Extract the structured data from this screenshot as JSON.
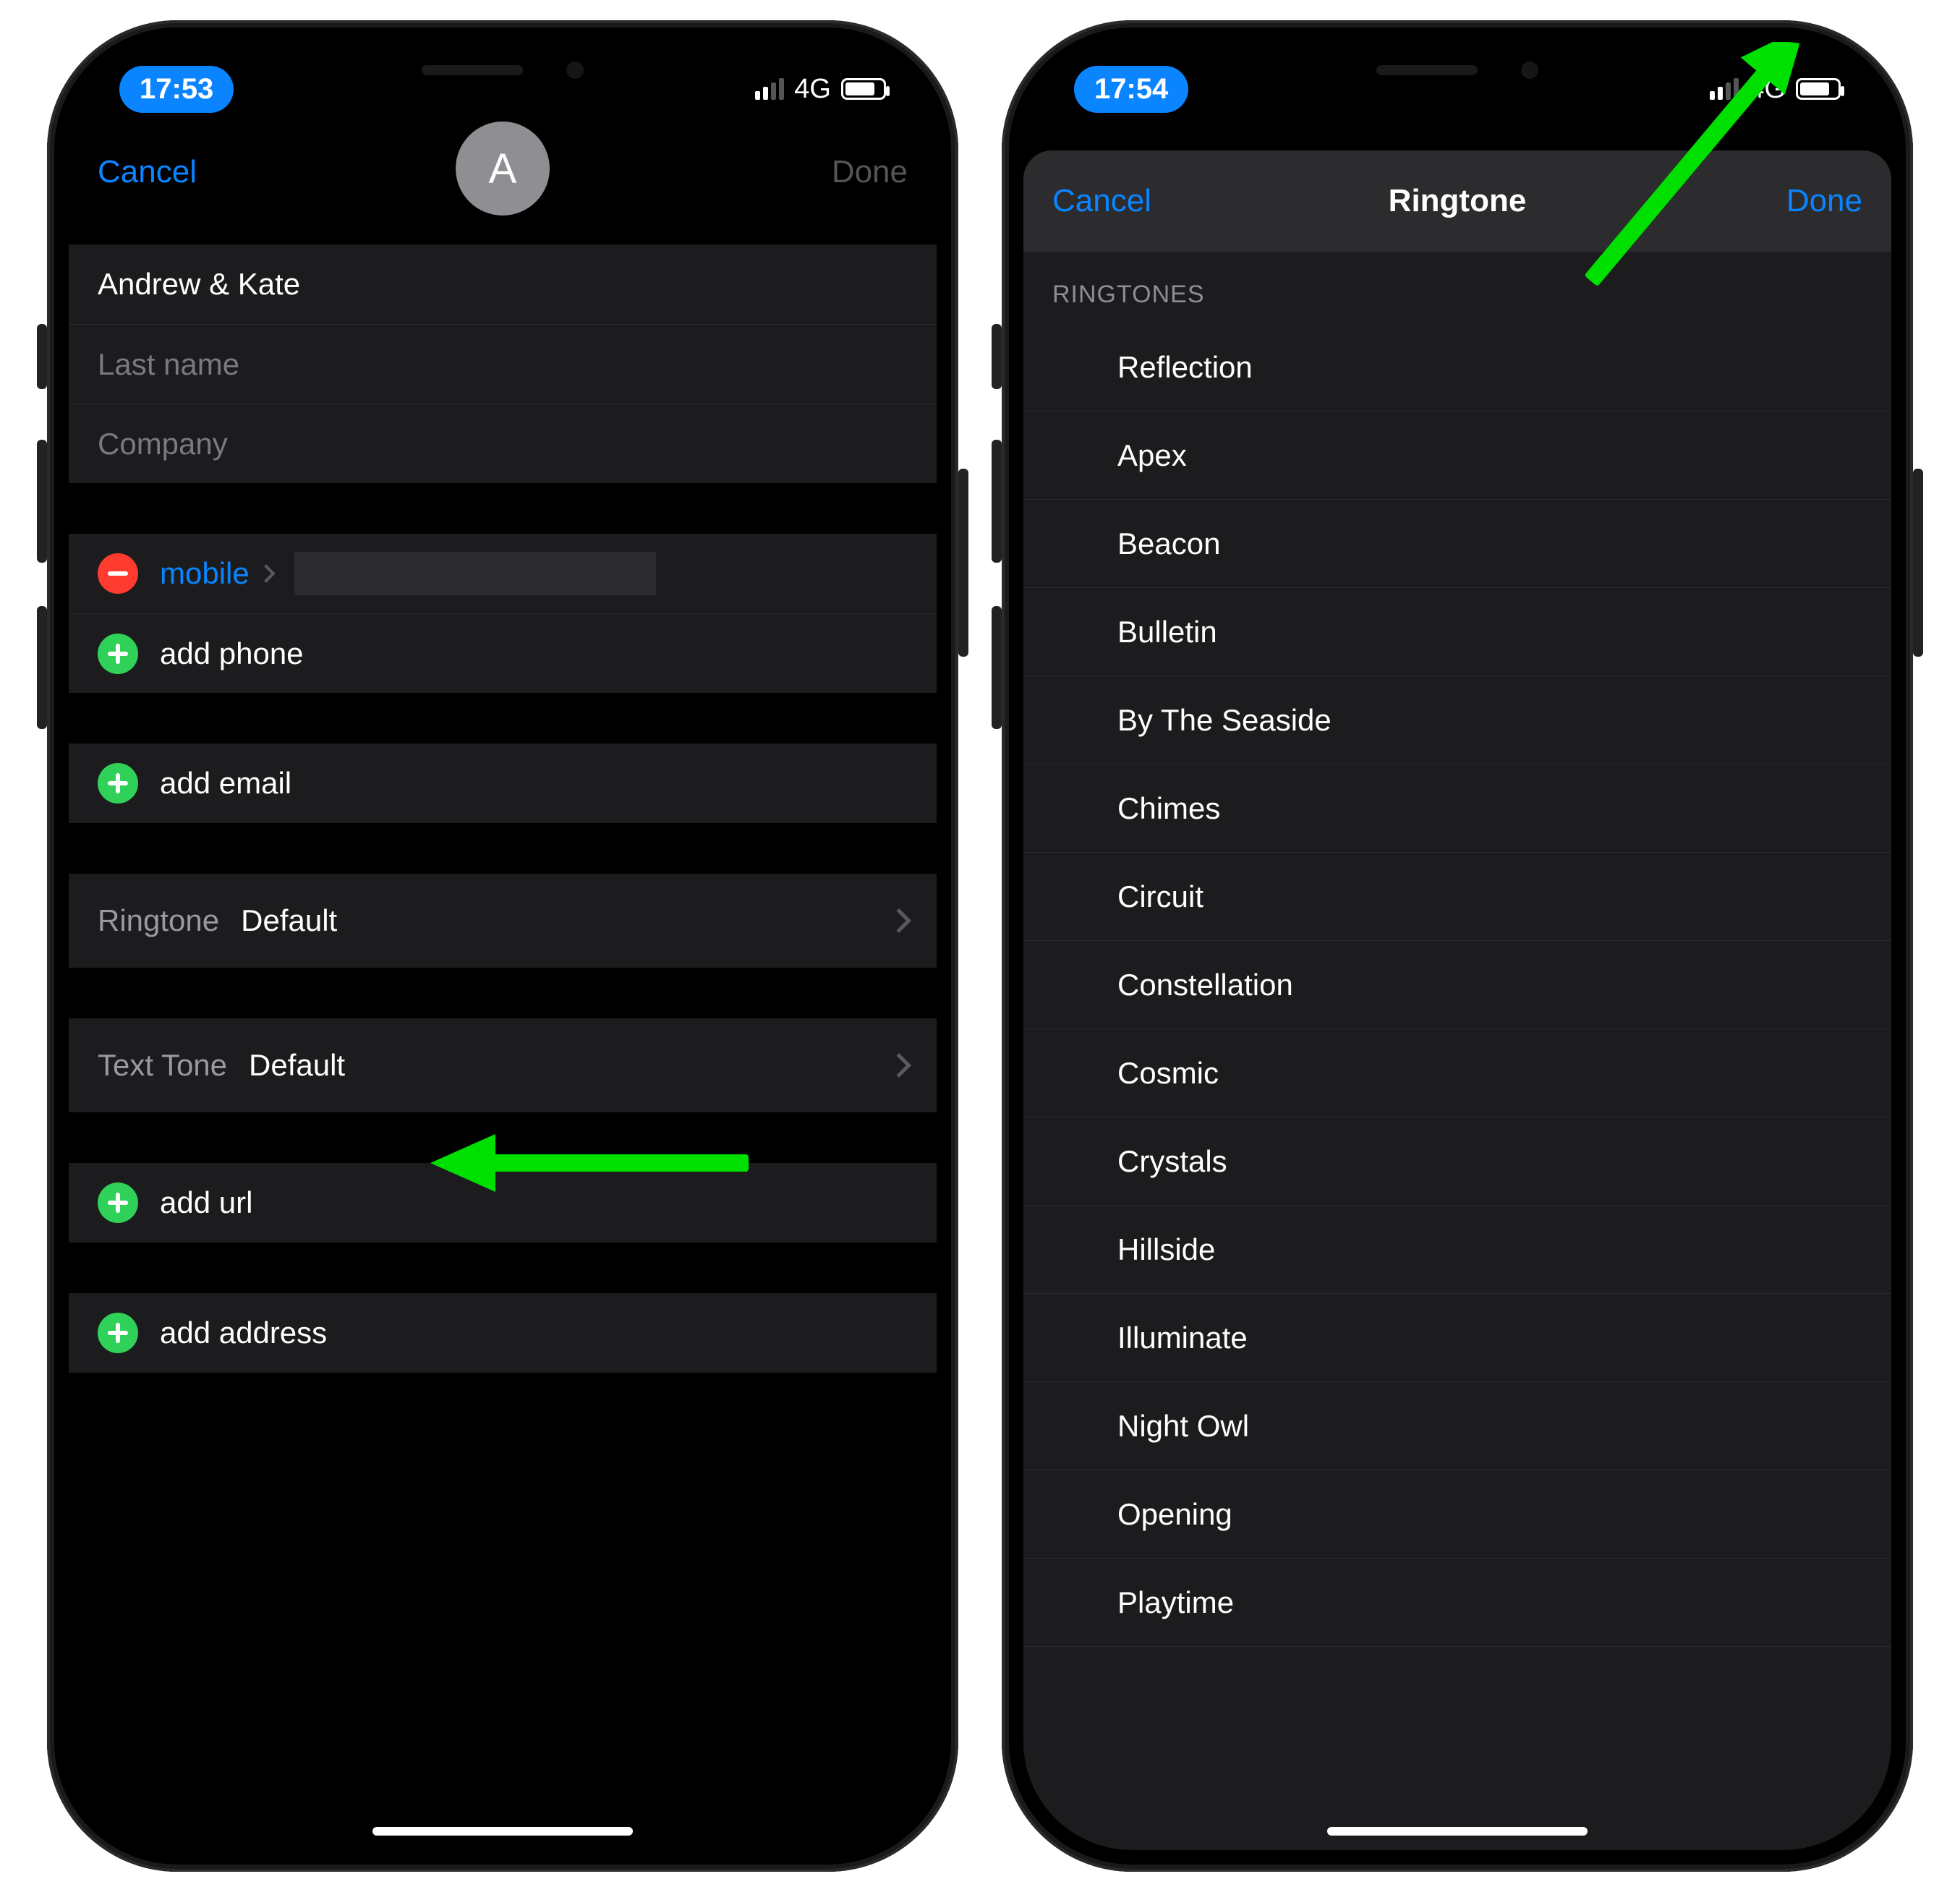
{
  "left": {
    "status": {
      "time": "17:53",
      "network": "4G"
    },
    "nav": {
      "cancel": "Cancel",
      "done": "Done"
    },
    "avatar_initial": "A",
    "fields": {
      "first_name": "Andrew & Kate",
      "last_name_ph": "Last name",
      "company_ph": "Company"
    },
    "phone": {
      "type_label": "mobile",
      "add_phone": "add phone"
    },
    "add_email": "add email",
    "ringtone": {
      "label": "Ringtone",
      "value": "Default"
    },
    "texttone": {
      "label": "Text Tone",
      "value": "Default"
    },
    "add_url": "add url",
    "add_address": "add address"
  },
  "right": {
    "status": {
      "time": "17:54",
      "network": "4G"
    },
    "nav": {
      "cancel": "Cancel",
      "title": "Ringtone",
      "done": "Done"
    },
    "section_header": "RINGTONES",
    "ringtones": [
      "Reflection",
      "Apex",
      "Beacon",
      "Bulletin",
      "By The Seaside",
      "Chimes",
      "Circuit",
      "Constellation",
      "Cosmic",
      "Crystals",
      "Hillside",
      "Illuminate",
      "Night Owl",
      "Opening",
      "Playtime"
    ]
  }
}
